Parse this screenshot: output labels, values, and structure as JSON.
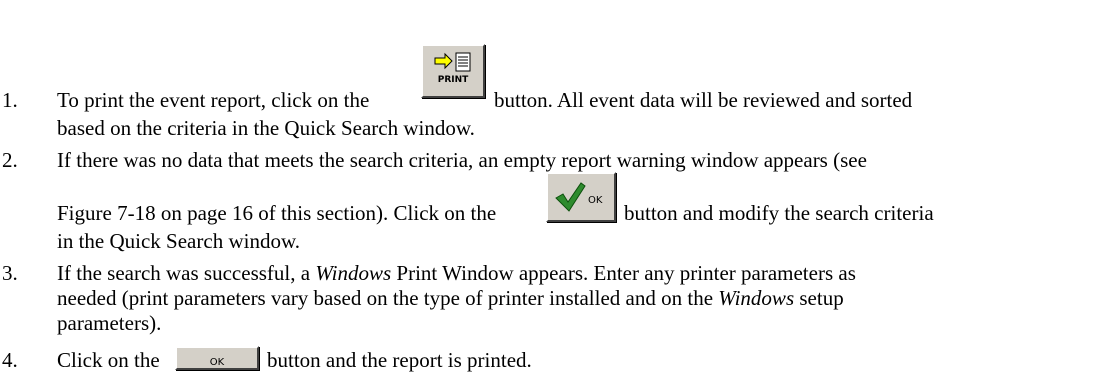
{
  "steps": [
    {
      "number": "1.",
      "line1_before": "To print the event report, click on the",
      "button_label": "PRINT",
      "line1_after": "button. All event data will be reviewed and sorted",
      "line2": "based on the criteria in the Quick Search window."
    },
    {
      "number": "2.",
      "line1": "If there was no data that meets the search criteria, an empty report warning window appears (see",
      "line2_before": "Figure 7-18 on page 16 of this section). Click on the",
      "button_label": "OK",
      "line2_after": "button and modify the search criteria",
      "line3": "in the Quick Search window."
    },
    {
      "number": "3.",
      "line1_before": "If the search was successful, a",
      "line1_italic": "Windows",
      "line1_after": "Print Window appears. Enter any printer parameters as",
      "line2_before": "needed (print parameters vary based on the type of printer installed and on the",
      "line2_italic": "Windows",
      "line2_after": "setup",
      "line3": "parameters)."
    },
    {
      "number": "4.",
      "line1_before": "Click on the",
      "button_label": "OK",
      "line1_after": "button and the report is printed."
    }
  ],
  "icons": {
    "print_button": "print-arrow-document-icon",
    "ok_button": "green-checkmark-icon"
  },
  "colors": {
    "button_face": "#d4d0c8",
    "check_green": "#2e8b2e",
    "arrow_yellow": "#ffff00"
  }
}
